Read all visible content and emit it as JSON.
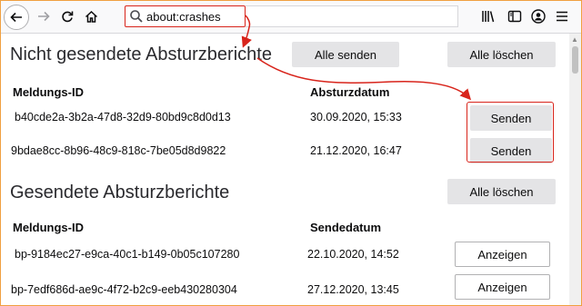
{
  "toolbar": {
    "url": "about:crashes",
    "icons": [
      "back-arrow-icon",
      "forward-arrow-icon",
      "reload-icon",
      "home-icon",
      "search-icon",
      "library-icon",
      "sidebar-icon",
      "account-icon",
      "menu-icon"
    ]
  },
  "unsent": {
    "title": "Nicht gesendete Absturzberichte",
    "send_all_label": "Alle senden",
    "delete_all_label": "Alle löschen",
    "col_id": "Meldungs-ID",
    "col_date": "Absturzdatum",
    "rows": [
      {
        "id": "b40cde2a-3b2a-47d8-32d9-80bd9c8d0d13",
        "date": "30.09.2020, 15:33",
        "action": "Senden"
      },
      {
        "id": "9bdae8cc-8b96-48c9-818c-7be05d8d9822",
        "date": "21.12.2020, 16:47",
        "action": "Senden"
      }
    ]
  },
  "sent": {
    "title": "Gesendete Absturzberichte",
    "delete_all_label": "Alle löschen",
    "col_id": "Meldungs-ID",
    "col_date": "Sendedatum",
    "rows": [
      {
        "id": "bp-9184ec27-e9ca-40c1-b149-0b05c107280",
        "date": "22.10.2020, 14:52",
        "action": "Anzeigen"
      },
      {
        "id": "bp-7edf686d-ae9c-4f72-b2c9-eeb430280304",
        "date": "27.12.2020, 13:45",
        "action": "Anzeigen"
      }
    ]
  },
  "colors": {
    "annotation": "#d8241b",
    "button": "#e4e4e6"
  }
}
